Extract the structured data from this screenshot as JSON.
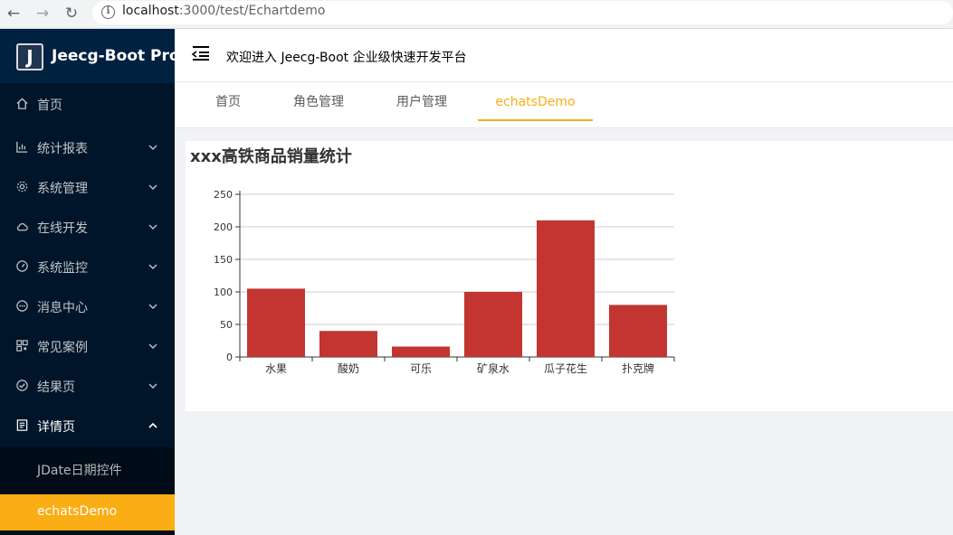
{
  "browser": {
    "url_host": "localhost",
    "url_rest": ":3000/test/Echartdemo"
  },
  "sidebar": {
    "brand": "Jeecg-Boot Pro",
    "logo_letter": "J",
    "items": [
      {
        "label": "首页",
        "icon": "home-icon"
      },
      {
        "label": "统计报表",
        "icon": "bar-chart-icon"
      },
      {
        "label": "系统管理",
        "icon": "setting-icon"
      },
      {
        "label": "在线开发",
        "icon": "cloud-icon"
      },
      {
        "label": "系统监控",
        "icon": "dashboard-icon"
      },
      {
        "label": "消息中心",
        "icon": "message-icon"
      },
      {
        "label": "常见案例",
        "icon": "qrcode-icon"
      },
      {
        "label": "结果页",
        "icon": "check-circle-icon"
      },
      {
        "label": "详情页",
        "icon": "profile-icon"
      }
    ],
    "sub_items": [
      {
        "label": "JDate日期控件"
      },
      {
        "label": "echatsDemo",
        "active": true
      }
    ]
  },
  "header": {
    "welcome": "欢迎进入 Jeecg-Boot 企业级快速开发平台"
  },
  "tabs": [
    {
      "label": "首页"
    },
    {
      "label": "角色管理"
    },
    {
      "label": "用户管理"
    },
    {
      "label": "echatsDemo",
      "active": true
    }
  ],
  "colors": {
    "accent": "#faad14",
    "sidebar_bg": "#001529",
    "bar": "#c23531"
  },
  "card": {
    "title": "xxx高铁商品销量统计"
  },
  "chart_data": {
    "type": "bar",
    "categories": [
      "水果",
      "酸奶",
      "可乐",
      "矿泉水",
      "瓜子花生",
      "扑克牌"
    ],
    "values": [
      105,
      40,
      16,
      100,
      210,
      80
    ],
    "title": "xxx高铁商品销量统计",
    "ylim": [
      0,
      250
    ],
    "yticks": [
      0,
      50,
      100,
      150,
      200,
      250
    ],
    "grid": true,
    "legend": "none"
  }
}
